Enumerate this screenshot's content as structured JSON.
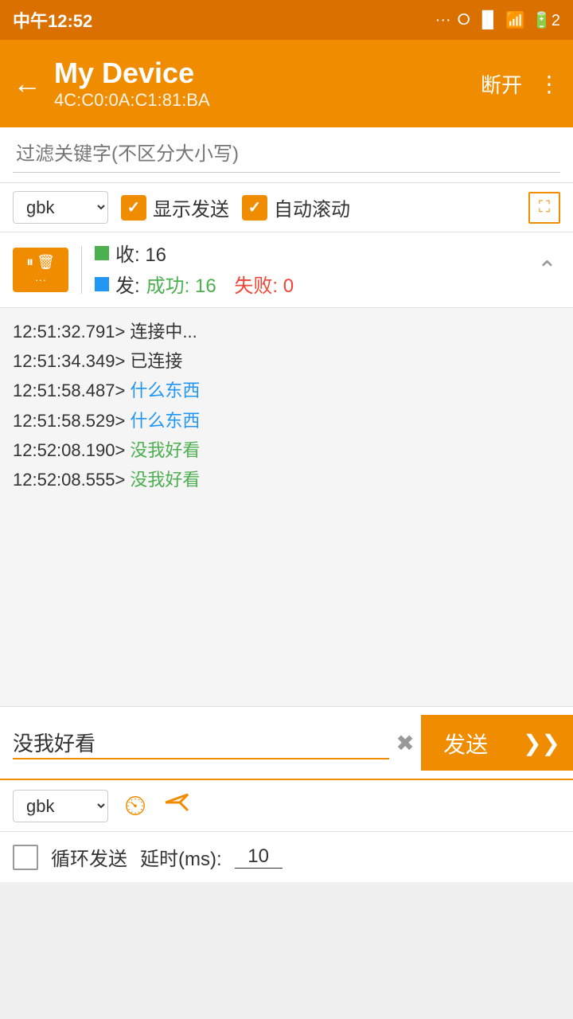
{
  "statusBar": {
    "time": "中午12:52",
    "battery": "2"
  },
  "appBar": {
    "deviceName": "My Device",
    "macAddress": "4C:C0:0A:C1:81:BA",
    "disconnectLabel": "断开",
    "moreIcon": "⋮"
  },
  "filter": {
    "placeholder": "过滤关键字(不区分大小写)"
  },
  "controls": {
    "encoding": "gbk",
    "showSendLabel": "显示发送",
    "autoScrollLabel": "自动滚动"
  },
  "stats": {
    "recvLabel": "收: 16",
    "sendLabel": "发:",
    "successLabel": "成功: 16",
    "failLabel": "失败: 0"
  },
  "log": {
    "entries": [
      {
        "time": "12:51:32.791>",
        "text": " 连接中...",
        "color": "normal"
      },
      {
        "time": "12:51:34.349>",
        "text": " 已连接",
        "color": "normal"
      },
      {
        "time": "12:51:58.487>",
        "text": " 什么东西",
        "color": "blue"
      },
      {
        "time": "12:51:58.529>",
        "text": " 什么东西",
        "color": "blue"
      },
      {
        "time": "12:52:08.190>",
        "text": " 没我好看",
        "color": "green"
      },
      {
        "time": "12:52:08.555>",
        "text": " 没我好看",
        "color": "green"
      }
    ]
  },
  "inputArea": {
    "messageValue": "没我好看",
    "sendButtonLabel": "发送",
    "expandIcon": "≫"
  },
  "bottomToolbar": {
    "encoding": "gbk"
  },
  "loopRow": {
    "label": "循环发送",
    "delayLabel": "延时(ms):",
    "delayValue": "10"
  }
}
